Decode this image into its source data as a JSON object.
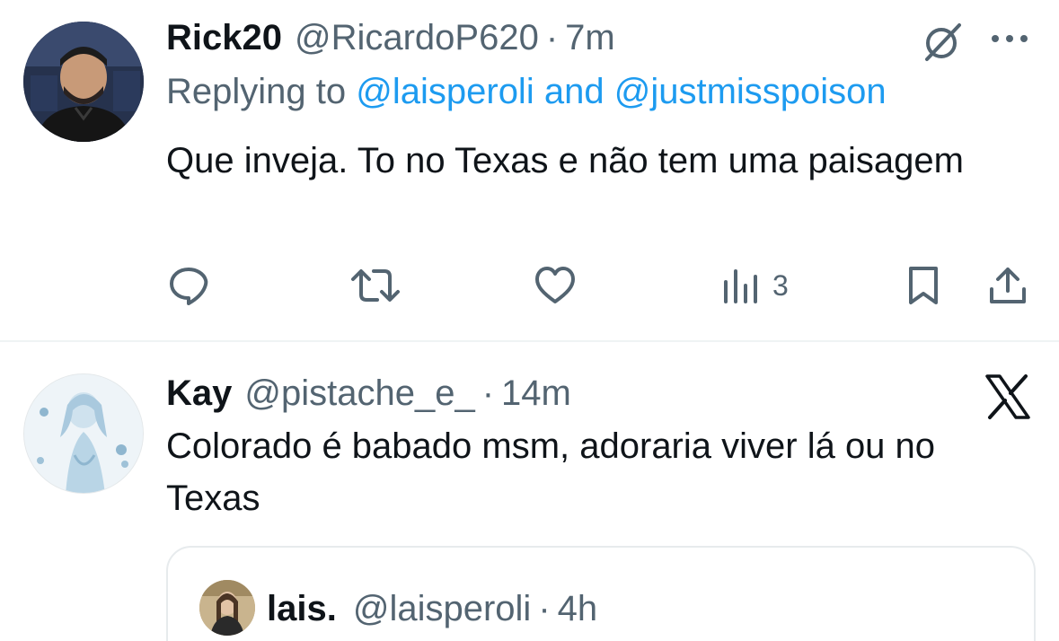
{
  "reply_tweet": {
    "name": "Rick20",
    "handle": "@RicardoP620",
    "separator": "·",
    "time": "7m",
    "replying_prefix": "Replying to",
    "reply_user_1": "@laisperoli",
    "reply_and": "and",
    "reply_user_2": "@justmisspoison",
    "text": "Que inveja. To no Texas e não tem uma paisagem",
    "views": "3",
    "icons": [
      "grok-icon",
      "more-icon",
      "reply-icon",
      "retweet-icon",
      "like-icon",
      "views-icon",
      "bookmark-icon",
      "share-icon"
    ]
  },
  "second_tweet": {
    "name": "Kay",
    "handle": "@pistache_e_",
    "separator": "·",
    "time": "14m",
    "text": "Colorado é babado msm, adoraria viver lá ou no Texas",
    "icons": [
      "x-logo-icon"
    ]
  },
  "quoted_tweet": {
    "name": "lais.",
    "handle": "@laisperoli",
    "separator": "·",
    "time": "4h"
  },
  "colors": {
    "link": "#1d9bf0",
    "secondary_text": "#536471",
    "primary_text": "#0f1419",
    "divider": "#eff3f4"
  }
}
